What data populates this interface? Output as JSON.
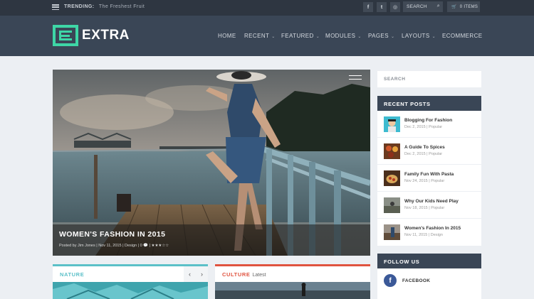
{
  "topbar": {
    "trending_label": "TRENDING:",
    "trending_text": "The Freshest Fruit",
    "social": [
      "f",
      "t",
      "◎"
    ],
    "search_label": "SEARCH",
    "cart_label": "0 ITEMS"
  },
  "header": {
    "logo_text": "EXTRA",
    "nav": [
      {
        "label": "HOME",
        "dropdown": false
      },
      {
        "label": "RECENT",
        "dropdown": true
      },
      {
        "label": "FEATURED",
        "dropdown": true
      },
      {
        "label": "MODULES",
        "dropdown": true
      },
      {
        "label": "PAGES",
        "dropdown": true
      },
      {
        "label": "LAYOUTS",
        "dropdown": true
      },
      {
        "label": "ECOMMERCE",
        "dropdown": false
      }
    ]
  },
  "feature": {
    "title": "WOMEN'S FASHION IN 2015",
    "meta": "Posted by Jim Jones | Nov 11, 2015 | Design | 0 💬 | ★★★☆☆"
  },
  "categories": [
    {
      "title": "NATURE",
      "subtitle": "",
      "color": "#5bc0c8"
    },
    {
      "title": "CULTURE",
      "subtitle": "Latest",
      "color": "#e0533f"
    }
  ],
  "sidebar": {
    "search_placeholder": "SEARCH",
    "recent_title": "RECENT POSTS",
    "posts": [
      {
        "title": "Blogging For Fashion",
        "meta": "Dec 2, 2015 | Popular"
      },
      {
        "title": "A Guide To Spices",
        "meta": "Dec 2, 2015 | Popular"
      },
      {
        "title": "Family Fun With Pasta",
        "meta": "Nov 24, 2015 | Popular"
      },
      {
        "title": "Why Our Kids Need Play",
        "meta": "Nov 18, 2015 | Popular"
      },
      {
        "title": "Women's Fashion In 2015",
        "meta": "Nov 11, 2015 | Design"
      }
    ],
    "follow_title": "FOLLOW US",
    "facebook_label": "FACEBOOK"
  },
  "colors": {
    "accent": "#3ed6a6",
    "header_bg": "#3a4656",
    "topbar_bg": "#2e3641",
    "page_bg": "#eceff3"
  }
}
